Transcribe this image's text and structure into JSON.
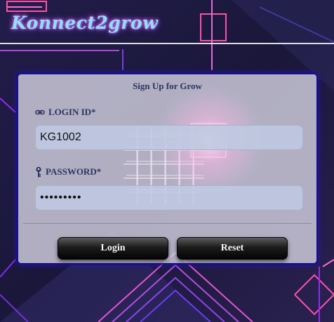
{
  "app": {
    "logo_text": "Konnect2grow"
  },
  "form": {
    "title": "Sign Up for Grow",
    "login_id": {
      "label": "LOGIN ID*",
      "value": "KG1002"
    },
    "password": {
      "label": "PASSWORD*",
      "value": "•••••••••"
    },
    "buttons": {
      "login": "Login",
      "reset": "Reset"
    }
  },
  "colors": {
    "card_border": "#1a0f8a",
    "label_text": "#2d3560",
    "background": "#1b1838"
  }
}
